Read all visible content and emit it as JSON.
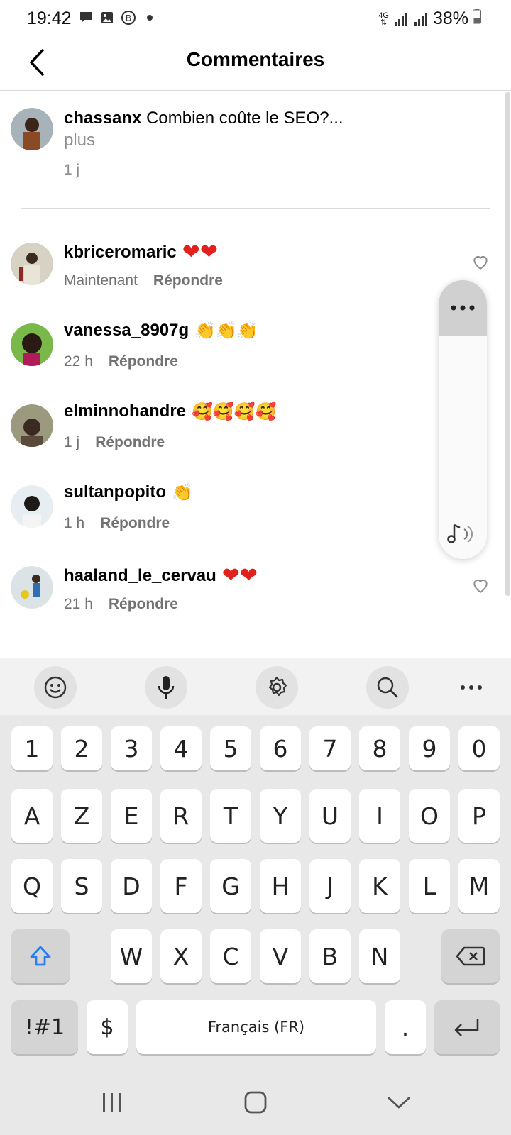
{
  "status_bar": {
    "time": "19:42",
    "network": "4G",
    "battery": "38%"
  },
  "header": {
    "title": "Commentaires"
  },
  "caption": {
    "username": "chassanx",
    "text": "Combien coûte le SEO?...",
    "more": "plus",
    "time": "1 j"
  },
  "comments": [
    {
      "username": "kbriceromaric",
      "emoji": "❤❤",
      "time": "Maintenant",
      "reply": "Répondre"
    },
    {
      "username": "vanessa_8907g",
      "emoji": "👏👏👏",
      "time": "22 h",
      "reply": "Répondre"
    },
    {
      "username": "elminnohandre",
      "emoji": "🥰🥰🥰🥰",
      "time": "1 j",
      "reply": "Répondre"
    },
    {
      "username": "sultanpopito",
      "emoji": "👏",
      "time": "1 h",
      "reply": "Répondre"
    },
    {
      "username": "haaland_le_cervau",
      "emoji": "❤❤",
      "time": "21 h",
      "reply": "Répondre"
    }
  ],
  "keyboard": {
    "row_numbers": [
      "1",
      "2",
      "3",
      "4",
      "5",
      "6",
      "7",
      "8",
      "9",
      "0"
    ],
    "row1": [
      "A",
      "Z",
      "E",
      "R",
      "T",
      "Y",
      "U",
      "I",
      "O",
      "P"
    ],
    "row2": [
      "Q",
      "S",
      "D",
      "F",
      "G",
      "H",
      "J",
      "K",
      "L",
      "M"
    ],
    "row3": [
      "W",
      "X",
      "C",
      "V",
      "B",
      "N"
    ],
    "symbols_key": "!#1",
    "currency_key": "$",
    "space_label": "Français (FR)",
    "period_key": ".",
    "toolbar_icons": [
      "emoji-icon",
      "microphone-icon",
      "settings-icon",
      "search-icon",
      "more-icon"
    ]
  },
  "colors": {
    "accent_blue": "#2a7df4",
    "heart_red": "#e0211e",
    "gray_text": "#737373"
  }
}
